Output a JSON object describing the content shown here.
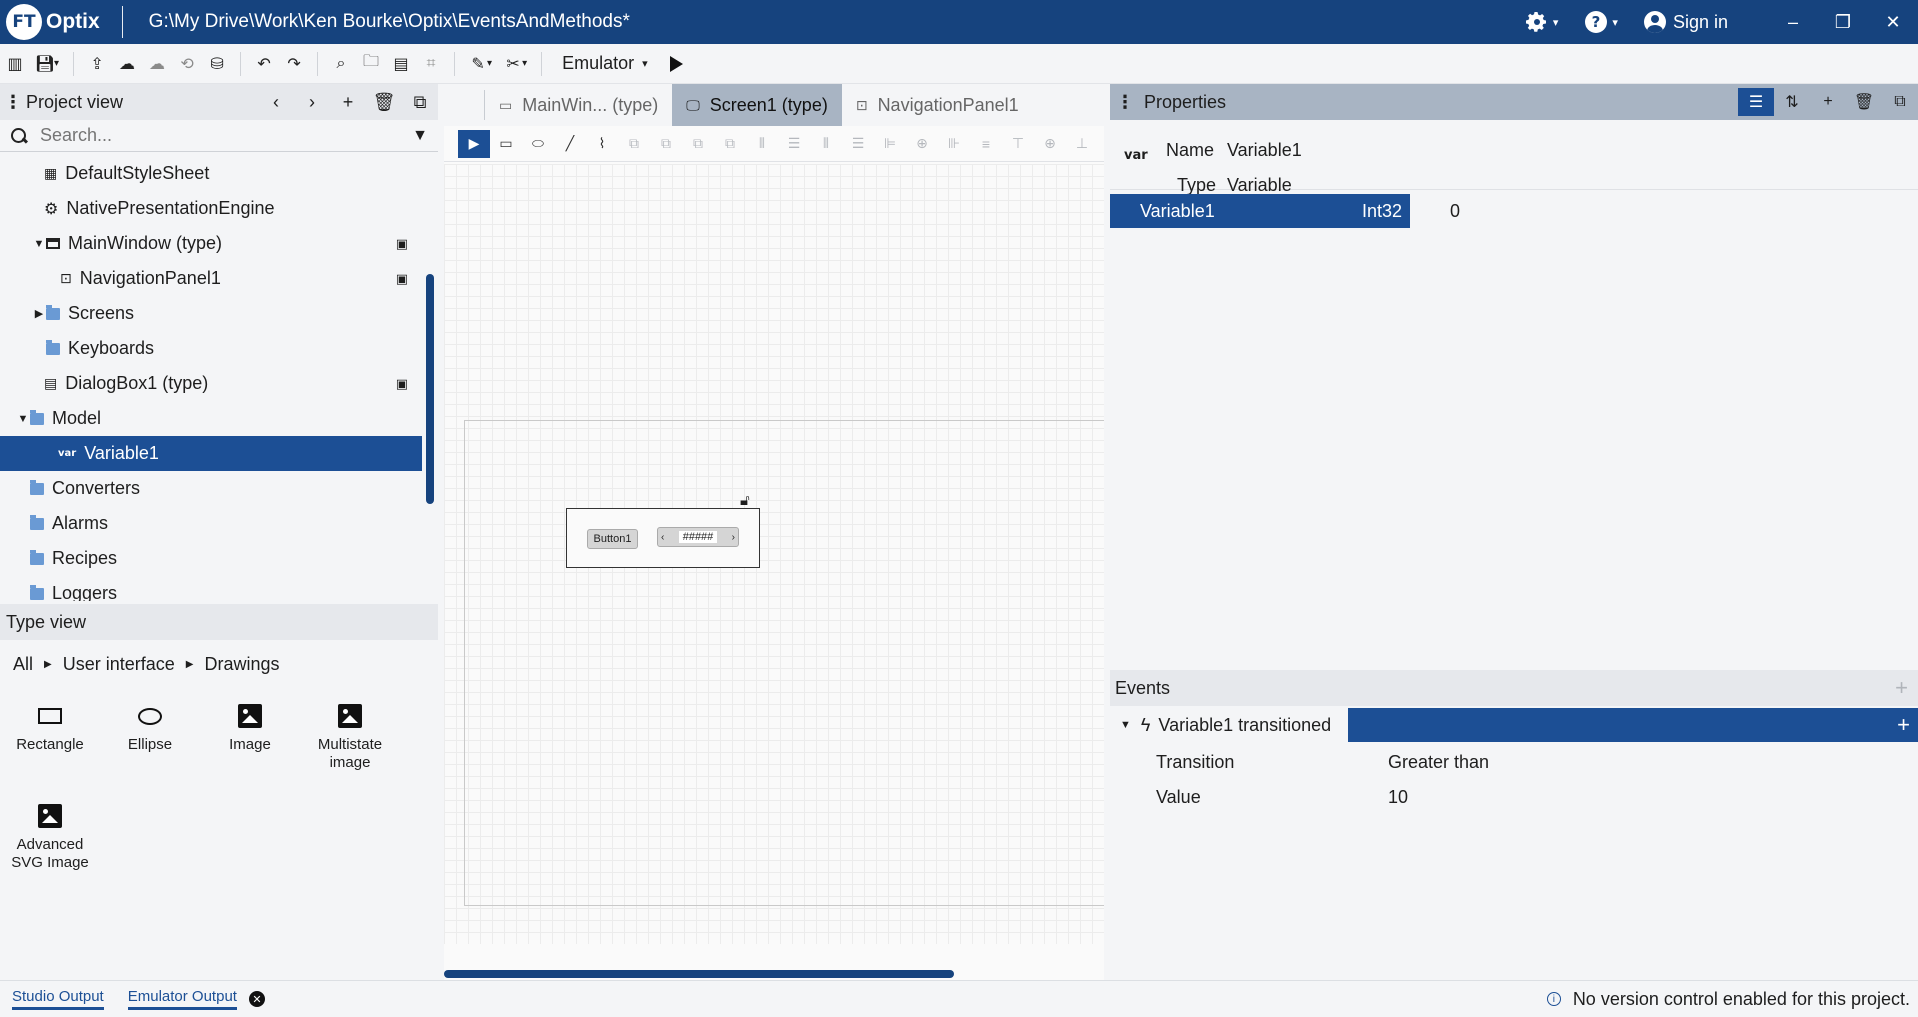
{
  "titlebar": {
    "logo_badge": "FT",
    "logo_text": "Optix",
    "path": "G:\\My Drive\\Work\\Ken Bourke\\Optix\\EventsAndMethods*",
    "sign_in": "Sign in",
    "minimize": "–",
    "restore": "❐",
    "close": "✕"
  },
  "toolbar": {
    "emulator_label": "Emulator"
  },
  "project_view": {
    "title": "Project view",
    "search_placeholder": "Search...",
    "items": [
      {
        "label": "DefaultStyleSheet"
      },
      {
        "label": "NativePresentationEngine"
      },
      {
        "label": "MainWindow (type)"
      },
      {
        "label": "NavigationPanel1"
      },
      {
        "label": "Screens"
      },
      {
        "label": "Keyboards"
      },
      {
        "label": "DialogBox1 (type)"
      },
      {
        "label": "Model"
      },
      {
        "label": "Variable1",
        "icon_text": "var"
      },
      {
        "label": "Converters"
      },
      {
        "label": "Alarms"
      },
      {
        "label": "Recipes"
      },
      {
        "label": "Loggers"
      }
    ]
  },
  "type_view": {
    "title": "Type view",
    "breadcrumb": [
      "All",
      "User interface",
      "Drawings"
    ],
    "items": [
      {
        "label": "Rectangle"
      },
      {
        "label": "Ellipse"
      },
      {
        "label": "Image"
      },
      {
        "label": "Multistate image"
      },
      {
        "label": "Advanced SVG Image"
      }
    ]
  },
  "editor": {
    "tabs": [
      {
        "label": "MainWin... (type)"
      },
      {
        "label": "Screen1 (type)"
      },
      {
        "label": "NavigationPanel1"
      }
    ],
    "canvas": {
      "button_label": "Button1",
      "spinbox_value": "#####"
    }
  },
  "properties": {
    "title": "Properties",
    "meta_icon": "var",
    "name_label": "Name",
    "name_value": "Variable1",
    "type_label": "Type",
    "type_value": "Variable",
    "row": {
      "name": "Variable1",
      "datatype": "Int32",
      "value": "0"
    }
  },
  "events": {
    "title": "Events",
    "event_label": "Variable1 transitioned",
    "fields": [
      {
        "key": "Transition",
        "value": "Greater than"
      },
      {
        "key": "Value",
        "value": "10"
      }
    ]
  },
  "statusbar": {
    "tabs": [
      "Studio Output",
      "Emulator Output"
    ],
    "message": "No version control enabled for this project."
  },
  "colors": {
    "titlebar": "#16437e",
    "selection": "#1c4f95",
    "active_tab": "#a8b4c3"
  }
}
